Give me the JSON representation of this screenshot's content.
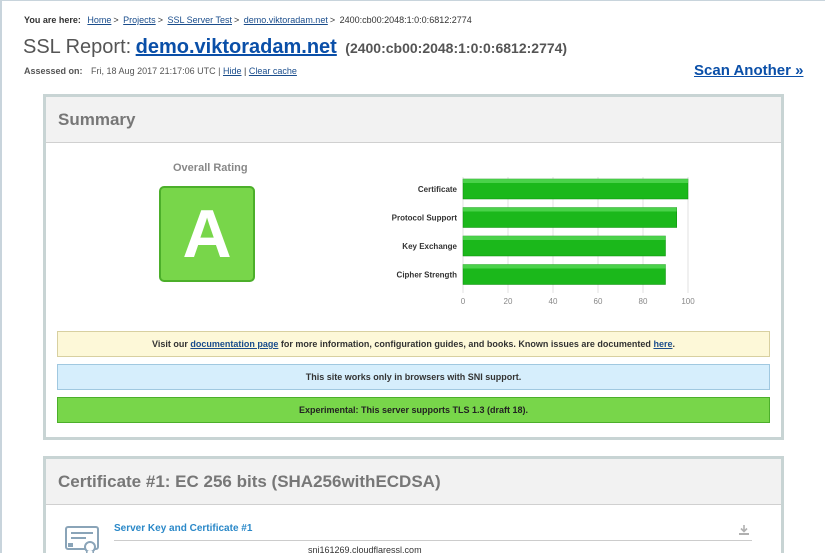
{
  "breadcrumb": {
    "lead": "You are here:",
    "items": [
      "Home",
      "Projects",
      "SSL Server Test",
      "demo.viktoradam.net"
    ],
    "current": "2400:cb00:2048:1:0:0:6812:2774"
  },
  "report": {
    "prefix": "SSL Report:",
    "host": "demo.viktoradam.net",
    "ip": "(2400:cb00:2048:1:0:0:6812:2774)"
  },
  "assessed": {
    "label": "Assessed on:",
    "value": "Fri, 18 Aug 2017 21:17:06 UTC |",
    "hide": "Hide",
    "sep": "|",
    "clear": "Clear cache"
  },
  "scan_another": "Scan Another »",
  "summary": {
    "heading": "Summary",
    "overall_label": "Overall Rating",
    "grade": "A",
    "grade_color": "#78d64a"
  },
  "chart_data": {
    "type": "bar",
    "orientation": "horizontal",
    "categories": [
      "Certificate",
      "Protocol Support",
      "Key Exchange",
      "Cipher Strength"
    ],
    "values": [
      100,
      95,
      90,
      90
    ],
    "xlim": [
      0,
      100
    ],
    "ticks": [
      0,
      20,
      40,
      60,
      80,
      100
    ],
    "bar_color": "#1bb81b"
  },
  "notices": {
    "docs": {
      "before": "Visit our",
      "link": "documentation page",
      "middle": "for more information, configuration guides, and books. Known issues are documented",
      "link2": "here",
      "after": "."
    },
    "sni": "This site works only in browsers with SNI support.",
    "tls13": "Experimental: This server supports TLS 1.3 (draft 18)."
  },
  "certificate": {
    "heading": "Certificate #1: EC 256 bits (SHA256withECDSA)",
    "sub": "Server Key and Certificate #1",
    "cn": "sni161269.cloudflaressl.com"
  }
}
